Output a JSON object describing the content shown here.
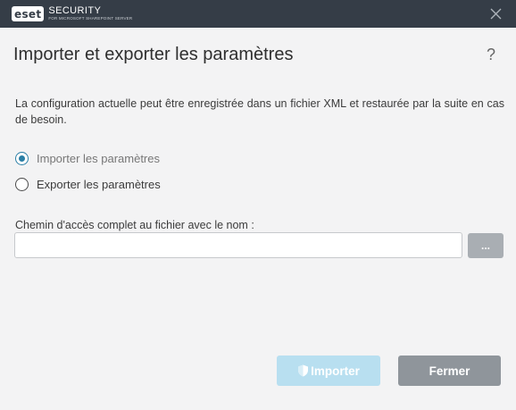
{
  "titlebar": {
    "logo_badge": "eset",
    "logo_title": "SECURITY",
    "logo_subtitle": "FOR MICROSOFT SHAREPOINT SERVER",
    "close_icon": "close-icon"
  },
  "dialog": {
    "title": "Importer et exporter les paramètres",
    "help_label": "?",
    "description": "La configuration actuelle peut être enregistrée dans un fichier XML et restaurée par la suite en cas de besoin."
  },
  "options": {
    "selected": "import",
    "import_label": "Importer les paramètres",
    "export_label": "Exporter les paramètres"
  },
  "path": {
    "label": "Chemin d'accès complet au fichier avec le nom :",
    "value": "",
    "browse_label": "..."
  },
  "buttons": {
    "import_label": "Importer",
    "import_icon": "shield-icon",
    "close_label": "Fermer"
  },
  "colors": {
    "titlebar": "#353d47",
    "accent": "#2b7fa6",
    "import_disabled": "#b8dff0",
    "close_button": "#8f959b",
    "background": "#f3f3f4"
  }
}
